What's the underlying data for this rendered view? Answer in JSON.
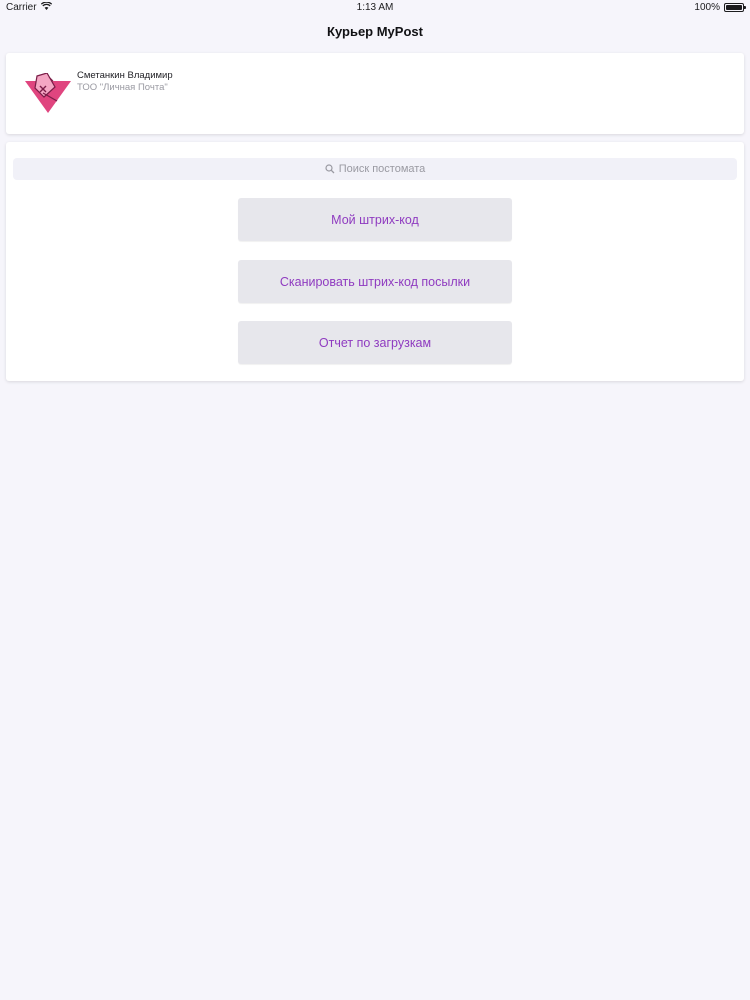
{
  "status_bar": {
    "carrier": "Carrier",
    "time": "1:13 AM",
    "battery": "100%",
    "battery_level": 1.0
  },
  "header": {
    "title": "Курьер MyPost"
  },
  "profile": {
    "name": "Сметанкин Владимир",
    "company": "ТОО \"Личная Почта\"",
    "logo_icon": "mypost-logo-icon",
    "brand_color": "#e0457f"
  },
  "search": {
    "placeholder": "Поиск постомата"
  },
  "actions": [
    {
      "label": "Мой штрих-код"
    },
    {
      "label": "Сканировать штрих-код посылки"
    },
    {
      "label": "Отчет по загрузкам"
    }
  ],
  "colors": {
    "accent_text": "#8f3bc0",
    "button_bg": "#e7e7ec",
    "page_bg": "#f6f5fb"
  }
}
